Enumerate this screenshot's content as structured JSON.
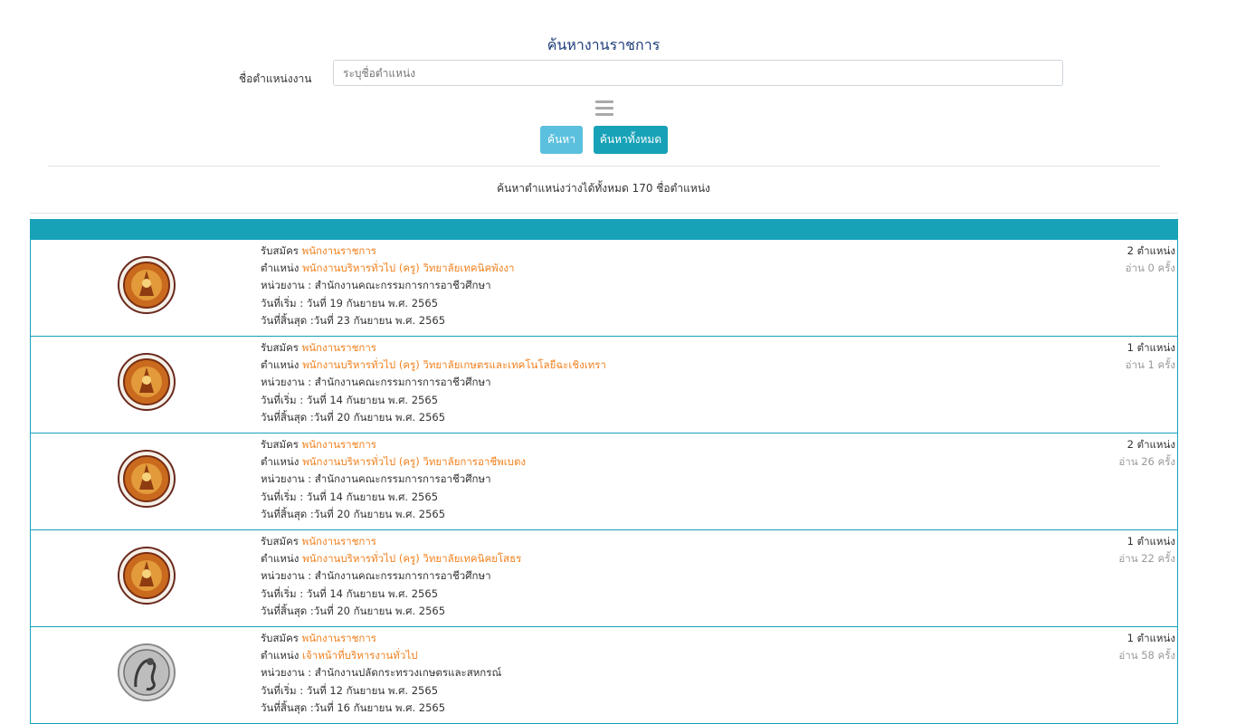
{
  "header": {
    "title": "ค้นหางานราชการ",
    "position_label": "ชื่อตำแหน่งงาน",
    "search_placeholder": "ระบุชื่อตำแหน่ง",
    "search_button": "ค้นหา",
    "search_all_button": "ค้นหาทั้งหมด",
    "result_summary": "ค้นหาตำแหน่งว่างได้ทั้งหมด 170 ชื่อตำแหน่ง"
  },
  "colors": {
    "title": "#1e3d7a",
    "accent": "#17a2b8",
    "search_button": "#5bc0de",
    "highlight": "#f0811e"
  },
  "jobs": [
    {
      "logo": "vocational-education-seal-icon",
      "apply_label": "รับสมัคร",
      "apply_type": "พนักงานราชการ",
      "position_label": "ตำแหน่ง",
      "position": "พนักงานบริหารทั่วไป (ครู) วิทยาลัยเทคนิคพังงา",
      "agency": "หน่วยงาน : สำนักงานคณะกรรมการการอาชีวศึกษา",
      "start": "วันที่เริ่ม : วันที่ 19 กันยายน พ.ศ. 2565",
      "end": "วันที่สิ้นสุด :วันที่ 23 กันยายน พ.ศ. 2565",
      "positions": "2 ตำแหน่ง",
      "reads": "อ่าน 0 ครั้ง"
    },
    {
      "logo": "vocational-education-seal-icon",
      "apply_label": "รับสมัคร",
      "apply_type": "พนักงานราชการ",
      "position_label": "ตำแหน่ง",
      "position": "พนักงานบริหารทั่วไป (ครู) วิทยาลัยเกษตรและเทคโนโลยีฉะเชิงเทรา",
      "agency": "หน่วยงาน : สำนักงานคณะกรรมการการอาชีวศึกษา",
      "start": "วันที่เริ่ม : วันที่ 14 กันยายน พ.ศ. 2565",
      "end": "วันที่สิ้นสุด :วันที่ 20 กันยายน พ.ศ. 2565",
      "positions": "1 ตำแหน่ง",
      "reads": "อ่าน 1 ครั้ง"
    },
    {
      "logo": "vocational-education-seal-icon",
      "apply_label": "รับสมัคร",
      "apply_type": "พนักงานราชการ",
      "position_label": "ตำแหน่ง",
      "position": "พนักงานบริหารทั่วไป (ครู) วิทยาลัยการอาชีพเบตง",
      "agency": "หน่วยงาน : สำนักงานคณะกรรมการการอาชีวศึกษา",
      "start": "วันที่เริ่ม : วันที่ 14 กันยายน พ.ศ. 2565",
      "end": "วันที่สิ้นสุด :วันที่ 20 กันยายน พ.ศ. 2565",
      "positions": "2 ตำแหน่ง",
      "reads": "อ่าน 26 ครั้ง"
    },
    {
      "logo": "vocational-education-seal-icon",
      "apply_label": "รับสมัคร",
      "apply_type": "พนักงานราชการ",
      "position_label": "ตำแหน่ง",
      "position": "พนักงานบริหารทั่วไป (ครู) วิทยาลัยเทคนิคยโสธร",
      "agency": "หน่วยงาน : สำนักงานคณะกรรมการการอาชีวศึกษา",
      "start": "วันที่เริ่ม : วันที่ 14 กันยายน พ.ศ. 2565",
      "end": "วันที่สิ้นสุด :วันที่ 20 กันยายน พ.ศ. 2565",
      "positions": "1 ตำแหน่ง",
      "reads": "อ่าน 22 ครั้ง"
    },
    {
      "logo": "agriculture-ministry-seal-icon",
      "apply_label": "รับสมัคร",
      "apply_type": "พนักงานราชการ",
      "position_label": "ตำแหน่ง",
      "position": "เจ้าหน้าที่บริหารงานทั่วไป",
      "agency": "หน่วยงาน : สำนักงานปลัดกระทรวงเกษตรและสหกรณ์",
      "start": "วันที่เริ่ม : วันที่ 12 กันยายน พ.ศ. 2565",
      "end": "วันที่สิ้นสุด :วันที่ 16 กันยายน พ.ศ. 2565",
      "positions": "1 ตำแหน่ง",
      "reads": "อ่าน 58 ครั้ง"
    }
  ]
}
